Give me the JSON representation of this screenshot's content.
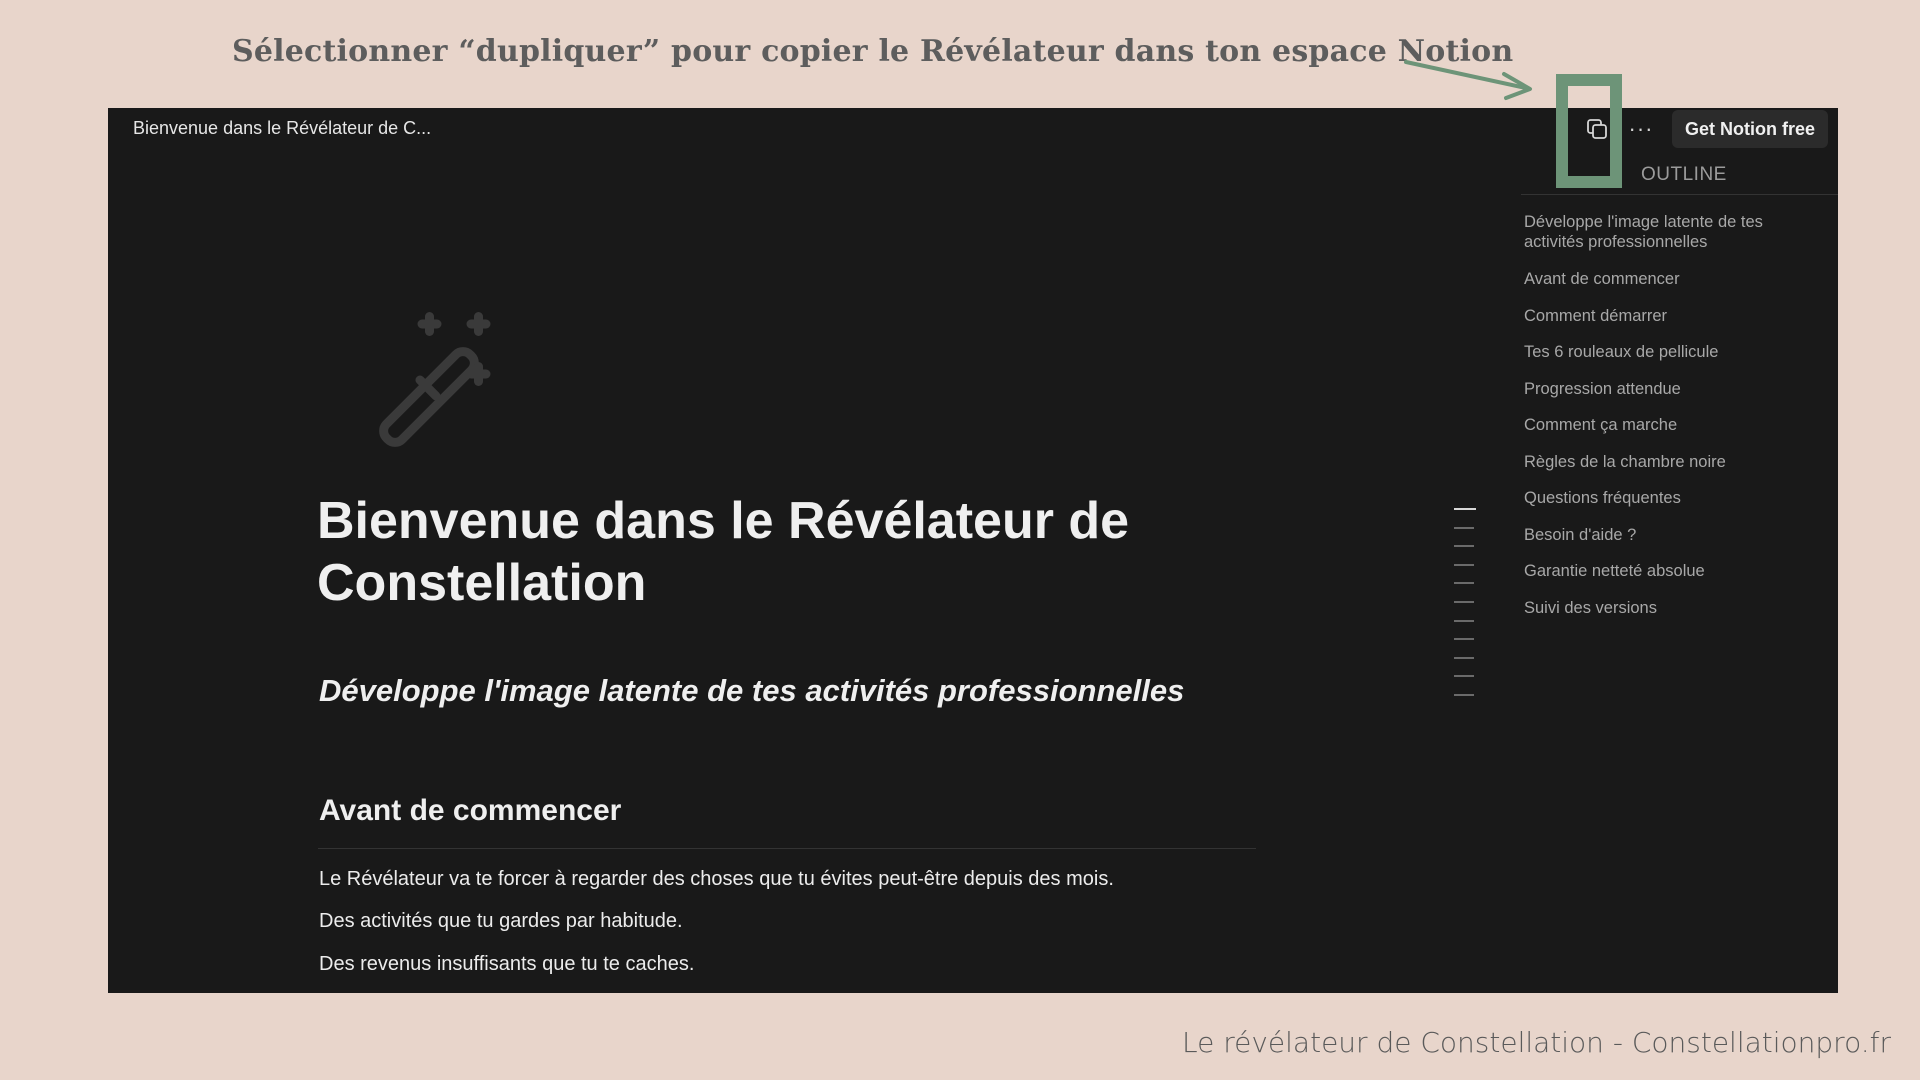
{
  "instruction": "Sélectionner “dupliquer” pour copier le Révélateur dans ton espace Notion",
  "topbar": {
    "page_title": "Bienvenue dans le Révélateur de C...",
    "more_label": "···",
    "get_notion_label": "Get Notion free"
  },
  "outline": {
    "title": "OUTLINE",
    "items": [
      "Développe l'image latente de tes activités professionnelles",
      "Avant de commencer",
      "Comment démarrer",
      "Tes 6 rouleaux de pellicule",
      "Progression attendue",
      "Comment ça marche",
      "Règles de la chambre noire",
      "Questions fréquentes",
      "Besoin d'aide ?",
      "Garantie netteté absolue",
      "Suivi des versions"
    ]
  },
  "page": {
    "title": "Bienvenue dans le Révélateur de Constellation",
    "subtitle": "Développe l'image latente de tes activités professionnelles",
    "section_heading": "Avant de commencer",
    "paragraphs": [
      "Le Révélateur va te forcer à regarder des choses que tu évites peut-être depuis des mois.",
      "Des activités que tu gardes par habitude.",
      "Des revenus insuffisants que tu te caches."
    ]
  },
  "footer": "Le révélateur de Constellation - Constellationpro.fr",
  "colors": {
    "background": "#e8d5cb",
    "notion_dark": "#191919",
    "highlight_green": "#6d9478"
  },
  "icons": [
    "duplicate-icon",
    "more-icon",
    "magic-wand-icon",
    "arrow-icon"
  ]
}
